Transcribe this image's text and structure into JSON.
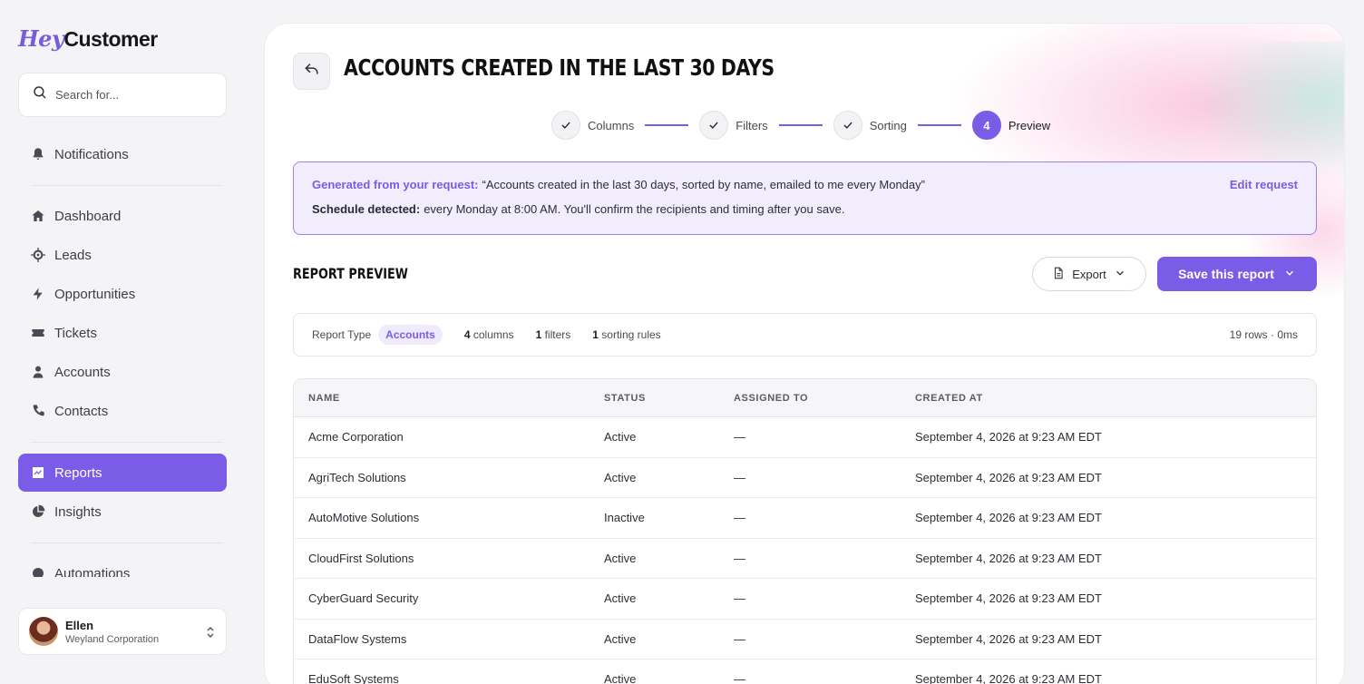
{
  "app": {
    "logo_part1": "Hey",
    "logo_part2": "Customer"
  },
  "search": {
    "placeholder": "Search for..."
  },
  "nav": {
    "notifications": "Notifications",
    "dashboard": "Dashboard",
    "leads": "Leads",
    "opportunities": "Opportunities",
    "tickets": "Tickets",
    "accounts": "Accounts",
    "contacts": "Contacts",
    "reports": "Reports",
    "insights": "Insights",
    "automations": "Automations"
  },
  "user": {
    "name": "Ellen",
    "org": "Weyland Corporation"
  },
  "page": {
    "title": "ACCOUNTS CREATED IN THE LAST 30 DAYS"
  },
  "stepper": {
    "steps": [
      {
        "label": "Columns",
        "state": "done"
      },
      {
        "label": "Filters",
        "state": "done"
      },
      {
        "label": "Sorting",
        "state": "done"
      },
      {
        "label": "Preview",
        "state": "current",
        "number": "4"
      }
    ]
  },
  "banner": {
    "lead": "Generated from your request:",
    "request": "“Accounts created in the last 30 days, sorted by name, emailed to me every Monday”",
    "schedule_lead": "Schedule detected:",
    "schedule": "every Monday at 8:00 AM. You'll confirm the recipients and timing after you save.",
    "edit_label": "Edit request"
  },
  "preview": {
    "title": "REPORT PREVIEW",
    "export_label": "Export",
    "save_label": "Save this report"
  },
  "meta": {
    "type_label": "Report Type",
    "type_value": "Accounts",
    "columns_count": "4",
    "columns_label": "columns",
    "filters_count": "1",
    "filters_label": "filters",
    "sorting_count": "1",
    "sorting_label": "sorting rules",
    "rows_info": "19 rows · 0ms"
  },
  "table": {
    "headers": [
      "NAME",
      "STATUS",
      "ASSIGNED TO",
      "CREATED AT"
    ],
    "rows": [
      [
        "Acme Corporation",
        "Active",
        "—",
        "September 4, 2026 at 9:23 AM EDT"
      ],
      [
        "AgriTech Solutions",
        "Active",
        "—",
        "September 4, 2026 at 9:23 AM EDT"
      ],
      [
        "AutoMotive Solutions",
        "Inactive",
        "—",
        "September 4, 2026 at 9:23 AM EDT"
      ],
      [
        "CloudFirst Solutions",
        "Active",
        "—",
        "September 4, 2026 at 9:23 AM EDT"
      ],
      [
        "CyberGuard Security",
        "Active",
        "—",
        "September 4, 2026 at 9:23 AM EDT"
      ],
      [
        "DataFlow Systems",
        "Active",
        "—",
        "September 4, 2026 at 9:23 AM EDT"
      ],
      [
        "EduSoft Systems",
        "Active",
        "—",
        "September 4, 2026 at 9:23 AM EDT"
      ]
    ]
  },
  "colors": {
    "accent": "#7b5ce6",
    "banner_bg": "#f1edfd"
  }
}
